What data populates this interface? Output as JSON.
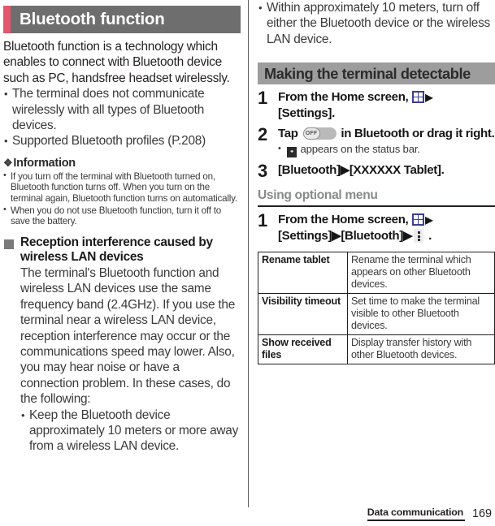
{
  "document": {
    "page_number": "169",
    "footer_title": "Data communication"
  },
  "left_column": {
    "chapter_title": "Bluetooth function",
    "lead_paragraph": "Bluetooth function is a technology which enables to connect with Bluetooth device such as PC, handsfree headset wirelessly.",
    "lead_bullets": [
      "The terminal does not communicate wirelessly with all types of Bluetooth devices.",
      "Supported Bluetooth profiles (P.208)"
    ],
    "information": {
      "heading": "Information",
      "glyph": "❖",
      "bullets": [
        "If you turn off the terminal with Bluetooth turned on, Bluetooth function turns off. When you turn on the terminal again, Bluetooth function turns on automatically.",
        "When you do not use Bluetooth function, turn it off to save the battery."
      ]
    },
    "interference_section": {
      "title": "Reception interference caused by wireless LAN devices",
      "body": "The terminal's Bluetooth function and wireless LAN devices use the same frequency band (2.4GHz). If you use the terminal near a wireless LAN device, reception interference may occur or the communications speed may lower. Also, you may hear noise or have a connection problem. In these cases, do the following:",
      "bullets": [
        "Keep the Bluetooth device approximately 10 meters or more away from a wireless LAN device."
      ]
    }
  },
  "right_column": {
    "continued_bullets": [
      "Within approximately 10 meters, turn off either the Bluetooth device or the wireless LAN device."
    ],
    "section_bar_title": "Making the terminal detectable",
    "steps": [
      {
        "number": "1",
        "text_before_icon": "From the Home screen, ",
        "icon": "app-grid-icon",
        "arrow": "▶",
        "text_after_icon": "[Settings]."
      },
      {
        "number": "2",
        "text_before_icon": "Tap ",
        "icon": "toggle-off-switch",
        "toggle_label": "OFF",
        "text_after_icon": " in Bluetooth or drag it right.",
        "sub_note_before": " ",
        "sub_note_icon": "bluetooth-status-icon",
        "sub_note_after": " appears on the status bar."
      },
      {
        "number": "3",
        "text": "[Bluetooth]▶[XXXXXX Tablet]."
      }
    ],
    "optional_menu": {
      "heading": "Using optional menu",
      "step_number": "1",
      "step_text_1": "From the Home screen, ",
      "step_icon_1": "app-grid-icon",
      "arrow": "▶",
      "step_text_2": "[Settings]▶[Bluetooth]▶",
      "step_icon_2": "overflow-menu-icon",
      "step_text_3": " .",
      "table": {
        "rows": [
          {
            "key": "Rename tablet",
            "value": "Rename the terminal which appears on other Bluetooth devices."
          },
          {
            "key": "Visibility timeout",
            "value": "Set time to make the terminal visible to other Bluetooth devices."
          },
          {
            "key": "Show received files",
            "value": "Display transfer history with other Bluetooth devices."
          }
        ]
      }
    }
  },
  "colors": {
    "accent_pink": "#e4566b",
    "title_bar_gray": "#6e6e6e",
    "section_bar_gray": "#9d9d9d",
    "marker_gray": "#7a7a7a",
    "app_icon_blue": "#3d3d8f"
  }
}
